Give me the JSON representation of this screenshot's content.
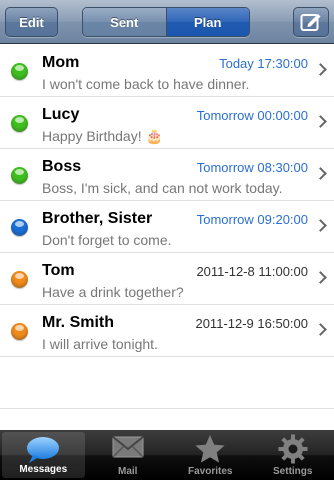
{
  "navbar": {
    "edit_label": "Edit",
    "segments": [
      {
        "label": "Sent",
        "selected": false
      },
      {
        "label": "Plan",
        "selected": true
      }
    ],
    "compose_icon": "compose-icon"
  },
  "messages": [
    {
      "name": "Mom",
      "time": "Today 17:30:00",
      "time_color": "#2a6fd6",
      "preview": "I won't come back to have dinner.",
      "status_color": "#3fbf1f"
    },
    {
      "name": "Lucy",
      "time": "Tomorrow 00:00:00",
      "time_color": "#2a6fd6",
      "preview": "Happy Birthday! 🎂",
      "status_color": "#3fbf1f"
    },
    {
      "name": "Boss",
      "time": "Tomorrow 08:30:00",
      "time_color": "#2a6fd6",
      "preview": "Boss, I'm sick, and can not work today.",
      "status_color": "#3fbf1f"
    },
    {
      "name": "Brother, Sister",
      "time": "Tomorrow 09:20:00",
      "time_color": "#2a6fd6",
      "preview": "Don't forget to come.",
      "status_color": "#1a6fd6"
    },
    {
      "name": "Tom",
      "time": "2011-12-8 11:00:00",
      "time_color": "#333333",
      "preview": "Have a drink together?",
      "status_color": "#f08a1a"
    },
    {
      "name": "Mr. Smith",
      "time": "2011-12-9 16:50:00",
      "time_color": "#333333",
      "preview": "I will arrive tonight.",
      "status_color": "#f08a1a"
    }
  ],
  "tabs": [
    {
      "label": "Messages",
      "icon": "chat-bubble-icon",
      "active": true
    },
    {
      "label": "Mail",
      "icon": "envelope-icon",
      "active": false
    },
    {
      "label": "Favorites",
      "icon": "star-icon",
      "active": false
    },
    {
      "label": "Settings",
      "icon": "gear-icon",
      "active": false
    }
  ]
}
